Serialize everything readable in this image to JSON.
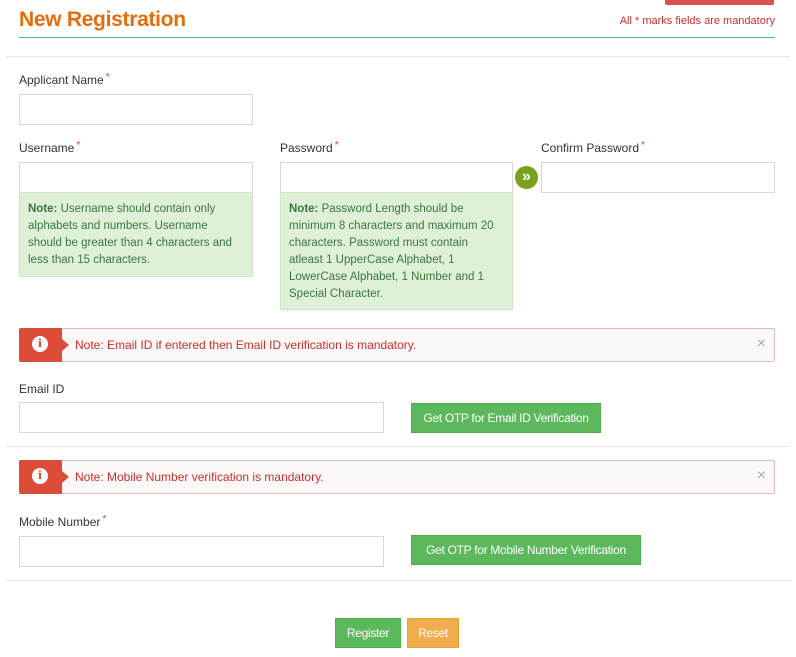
{
  "header": {
    "title": "New Registration",
    "mandatory_note": "All * marks fields are mandatory",
    "required_marker": "*"
  },
  "fields": {
    "applicant_name": {
      "label": "Applicant Name",
      "value": "",
      "required": true
    },
    "username": {
      "label": "Username",
      "value": "",
      "required": true,
      "note_prefix": "Note:",
      "note": " Username should contain only alphabets and numbers. Username should be greater than 4 characters and less than 15 characters."
    },
    "password": {
      "label": "Password",
      "value": "",
      "required": true,
      "note_prefix": "Note:",
      "note": " Password Length should be minimum 8 characters and maximum 20 characters. Password must contain atleast 1 UpperCase Alphabet, 1 LowerCase Alphabet, 1 Number and 1 Special Character."
    },
    "confirm_password": {
      "label": "Confirm Password",
      "value": "",
      "required": true
    },
    "email": {
      "label": "Email ID",
      "value": "",
      "required": false
    },
    "mobile": {
      "label": "Mobile Number",
      "value": "",
      "required": true
    }
  },
  "alerts": {
    "email": {
      "icon": "info-icon",
      "text": "Note: Email ID if entered then Email ID verification is mandatory.",
      "close": "×"
    },
    "mobile": {
      "icon": "info-icon",
      "text": "Note: Mobile Number verification is mandatory.",
      "close": "×"
    }
  },
  "icons": {
    "copy_arrow": "»",
    "info": "i"
  },
  "buttons": {
    "email_otp": "Get OTP for Email ID Verification",
    "mobile_otp": "Get OTP for Mobile Number Verification",
    "register": "Register",
    "reset": "Reset"
  },
  "colors": {
    "title": "#e46c0a",
    "accent_line": "#3fb8c4",
    "danger": "#dd4b39",
    "success": "#5cb85c",
    "warning": "#f0ad4e",
    "note_bg": "#dff0d8"
  }
}
